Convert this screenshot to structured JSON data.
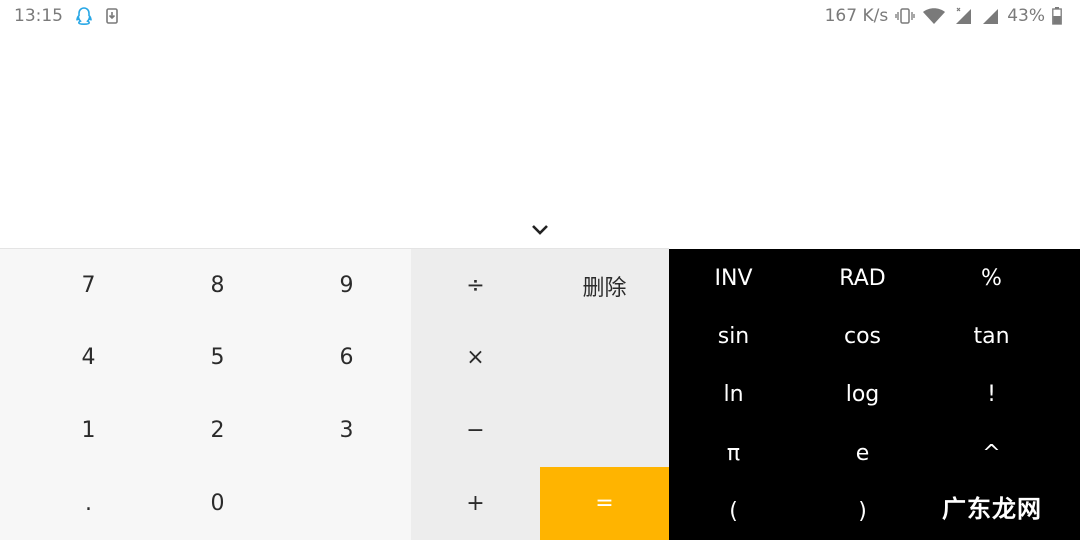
{
  "status_bar": {
    "time": "13:15",
    "net_speed": "167 K/s",
    "battery": "43%",
    "icons": [
      "qq-icon",
      "download-icon",
      "vibrate-icon",
      "wifi-icon",
      "signal-icon",
      "signal-icon",
      "battery-icon"
    ]
  },
  "display": {
    "expression": "",
    "result": ""
  },
  "digits": {
    "row1": [
      "7",
      "8",
      "9"
    ],
    "row2": [
      "4",
      "5",
      "6"
    ],
    "row3": [
      "1",
      "2",
      "3"
    ],
    "row4": [
      ".",
      "0"
    ]
  },
  "ops": {
    "divide": "÷",
    "delete": "删除",
    "multiply": "×",
    "minus": "−",
    "plus": "+",
    "equals": "="
  },
  "scientific": {
    "row1": [
      "INV",
      "RAD",
      "%"
    ],
    "row2": [
      "sin",
      "cos",
      "tan"
    ],
    "row3": [
      "ln",
      "log",
      "!"
    ],
    "row4": [
      "π",
      "e",
      "^"
    ],
    "row5": [
      "(",
      ")"
    ]
  },
  "watermark": "广东龙网",
  "colors": {
    "equals_bg": "#ffb400",
    "sci_bg": "#000000",
    "digits_bg": "#f7f7f7",
    "ops_bg": "#ededed"
  }
}
